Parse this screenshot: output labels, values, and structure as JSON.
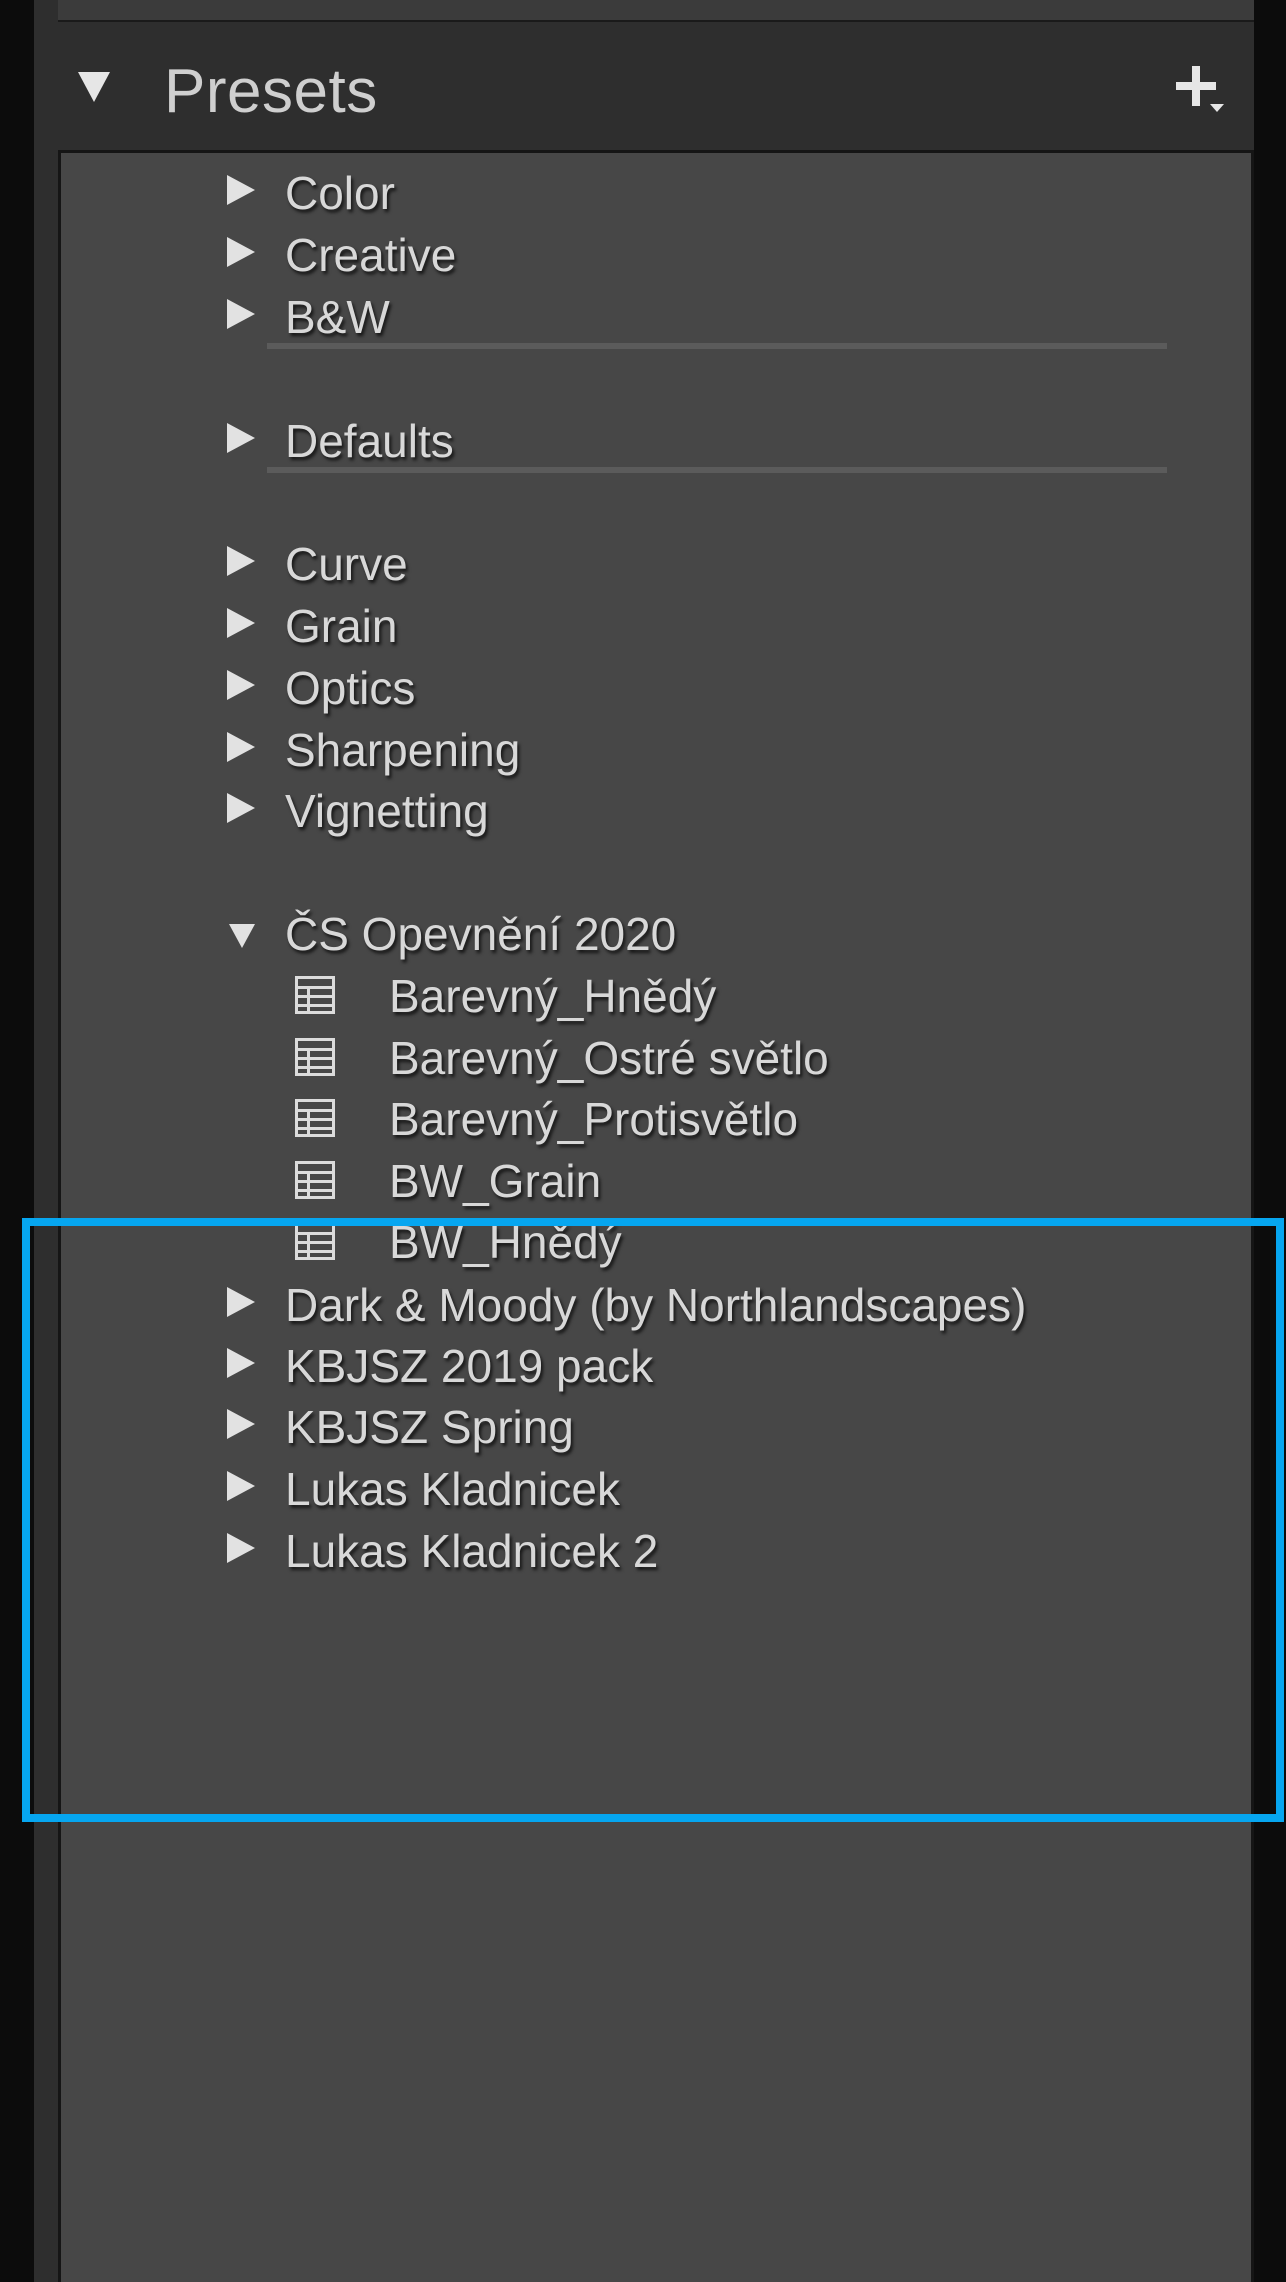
{
  "panel": {
    "title": "Presets",
    "add_icon": "plus-with-caret-icon",
    "collapse_icon": "triangle-down-icon"
  },
  "groups": [
    {
      "label": "Color",
      "expanded": false
    },
    {
      "label": "Creative",
      "expanded": false
    },
    {
      "label": "B&W",
      "expanded": false
    },
    {
      "label": "Defaults",
      "expanded": false
    },
    {
      "label": "Curve",
      "expanded": false
    },
    {
      "label": "Grain",
      "expanded": false
    },
    {
      "label": "Optics",
      "expanded": false
    },
    {
      "label": "Sharpening",
      "expanded": false
    },
    {
      "label": "Vignetting",
      "expanded": false
    },
    {
      "label": "ČS Opevnění 2020",
      "expanded": true,
      "presets": [
        "Barevný_Hnědý",
        "Barevný_Ostré světlo",
        "Barevný_Protisvětlo",
        "BW_Grain",
        "BW_Hnědý"
      ]
    },
    {
      "label": "Dark & Moody (by Northlandscapes)",
      "expanded": false
    },
    {
      "label": "KBJSZ 2019 pack",
      "expanded": false
    },
    {
      "label": "KBJSZ Spring",
      "expanded": false
    },
    {
      "label": "Lukas Kladnicek",
      "expanded": false
    },
    {
      "label": "Lukas Kladnicek 2",
      "expanded": false
    }
  ],
  "colors": {
    "highlight_border": "#06a6f0",
    "list_background": "#474747",
    "text": "#d8d8d8"
  }
}
